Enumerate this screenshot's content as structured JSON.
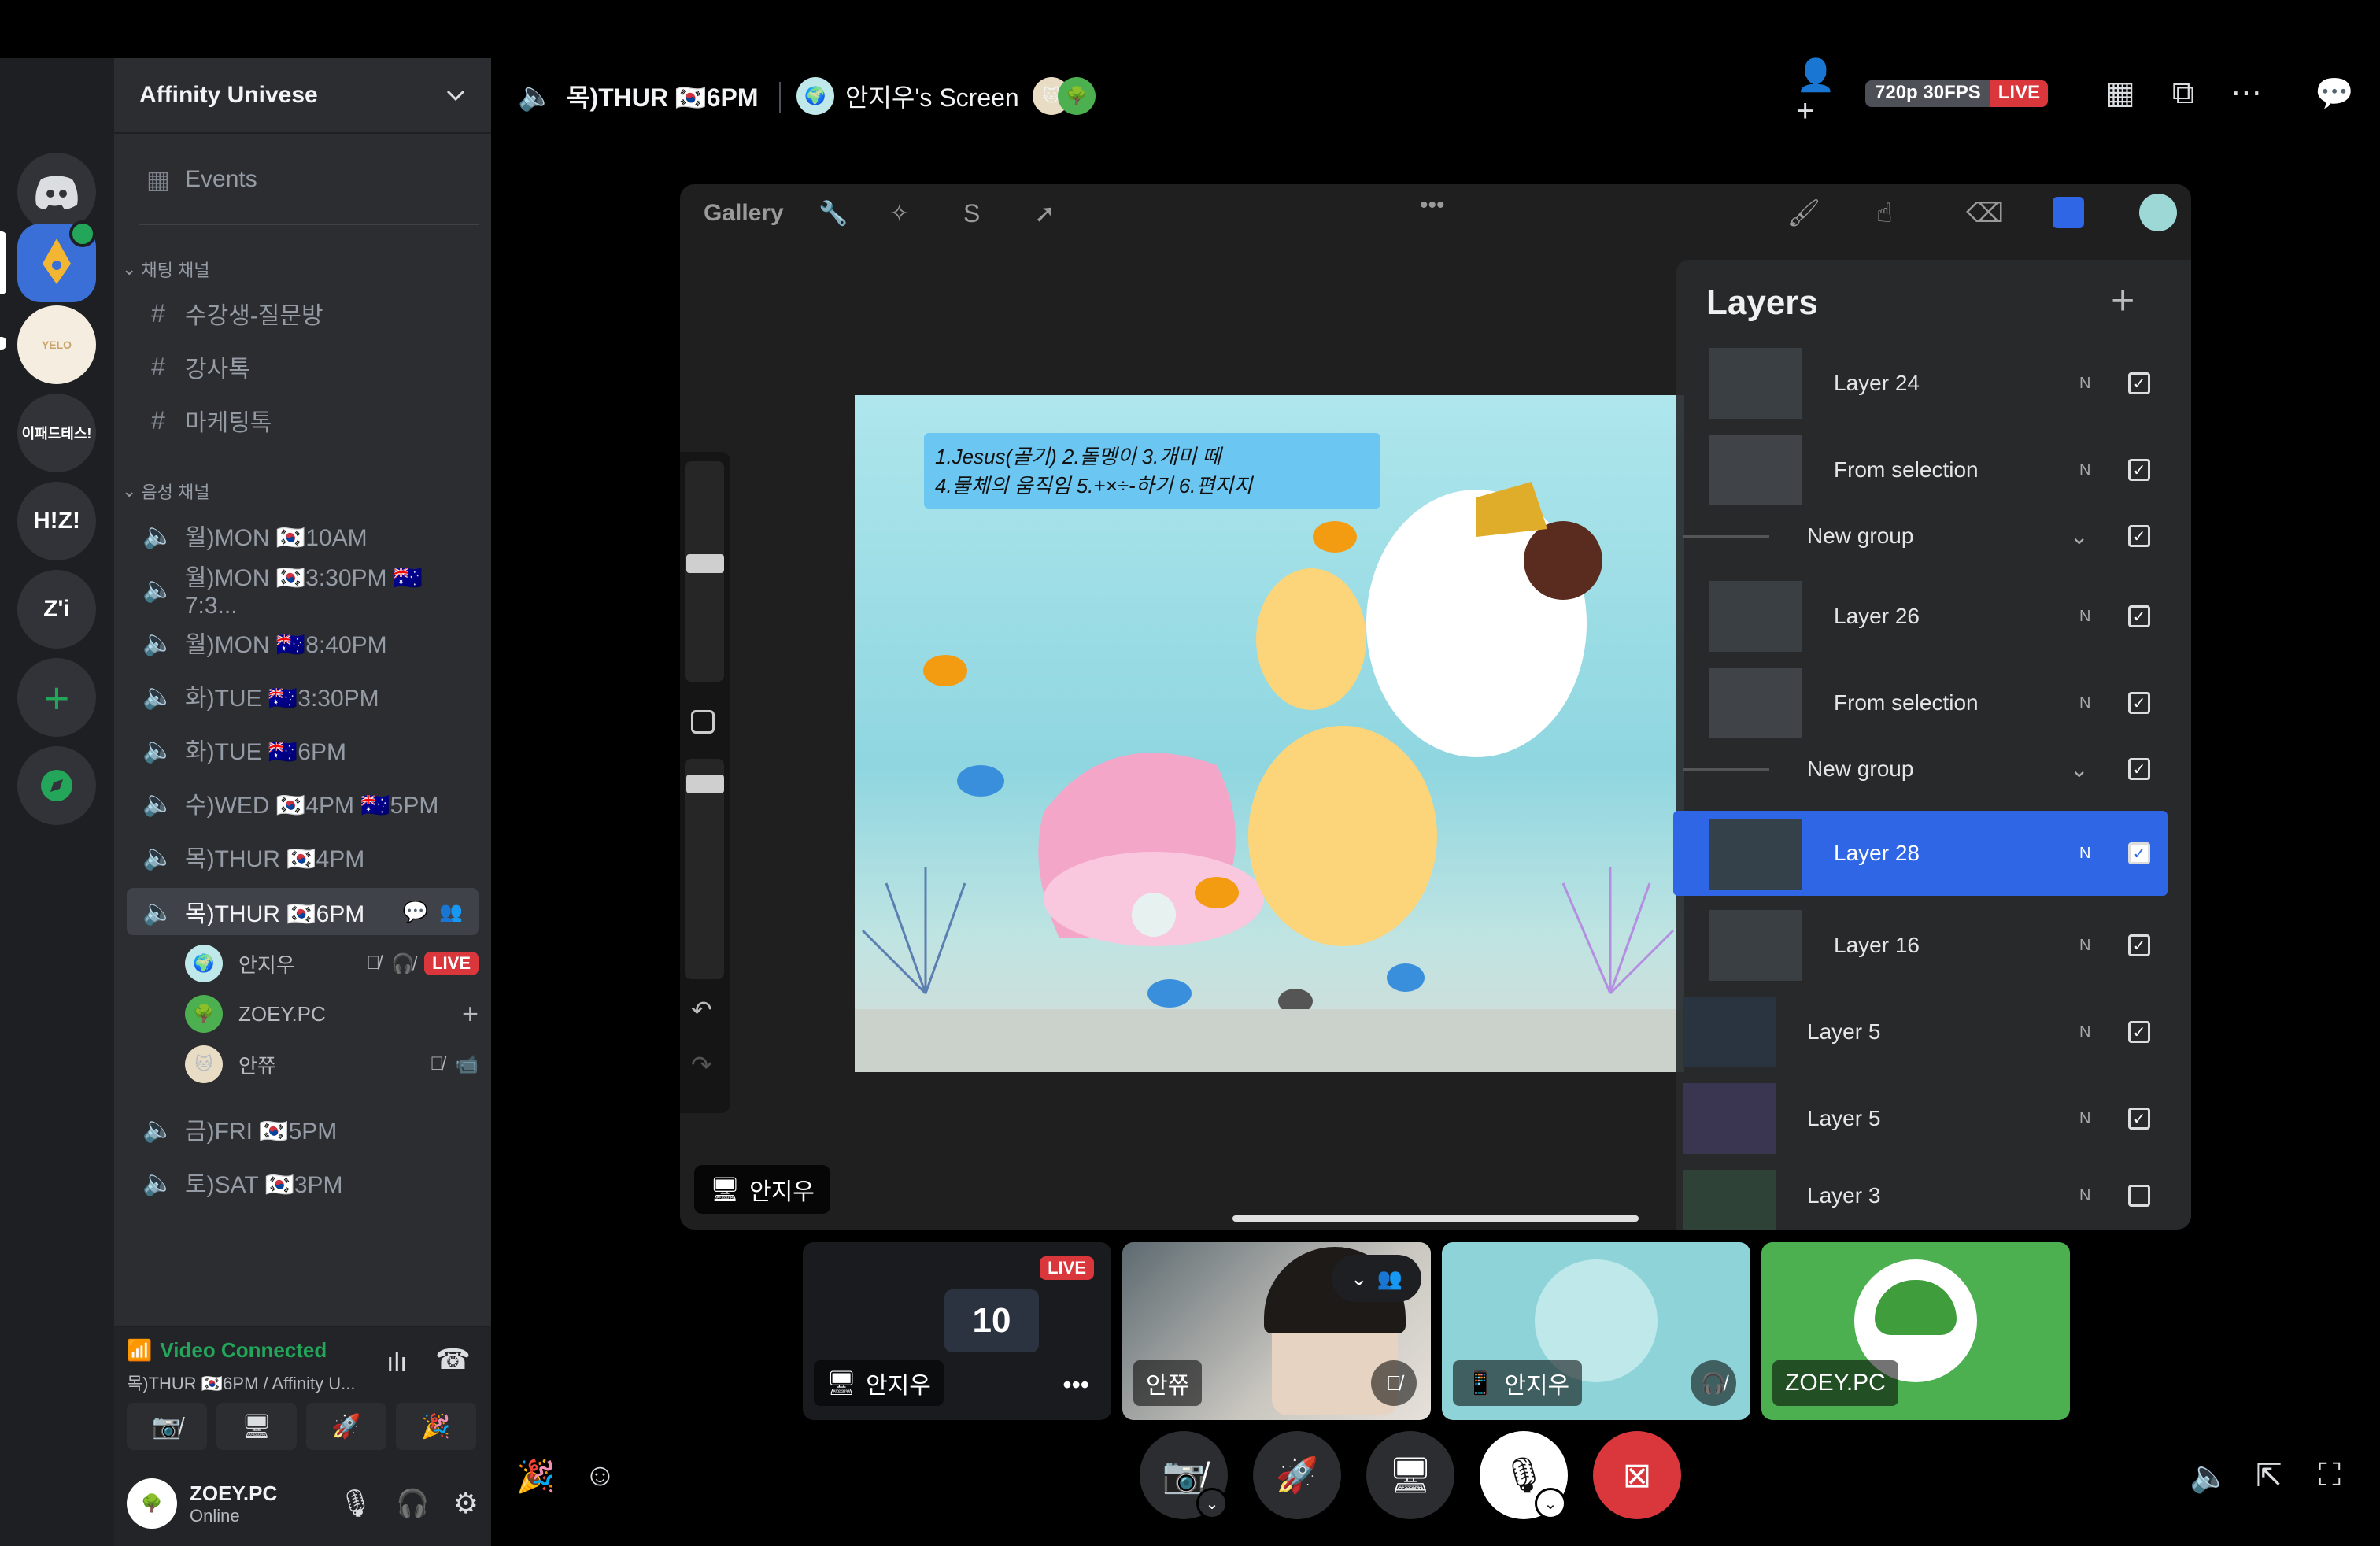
{
  "sidebar": {
    "server_name": "Affinity Univese",
    "events": "Events",
    "text_category": "채팅 채널",
    "text_channels": [
      "수강생-질문방",
      "강사톡",
      "마케팅톡"
    ],
    "voice_category": "음성 채널",
    "voice_channels": [
      "월)MON 🇰🇷10AM",
      "월)MON 🇰🇷3:30PM 🇦🇺7:3...",
      "월)MON 🇦🇺8:40PM",
      "화)TUE 🇦🇺3:30PM",
      "화)TUE 🇦🇺6PM",
      "수)WED 🇰🇷4PM 🇦🇺5PM",
      "목)THUR 🇰🇷4PM",
      "목)THUR 🇰🇷6PM"
    ],
    "voice_channels_after": [
      "금)FRI 🇰🇷5PM",
      "토)SAT 🇰🇷3PM"
    ],
    "participants": [
      {
        "name": "안지우",
        "badge": "LIVE"
      },
      {
        "name": "ZOEY.PC"
      },
      {
        "name": "안쮸"
      }
    ]
  },
  "rail": {
    "servers": [
      "",
      "",
      "",
      "이패드테스!",
      "H!Z!",
      "Z'i"
    ]
  },
  "voice_status": {
    "title": "Video Connected",
    "subtitle": "목)THUR 🇰🇷6PM / Affinity U..."
  },
  "user_panel": {
    "name": "ZOEY.PC",
    "status": "Online"
  },
  "topbar": {
    "channel": "목)THUR 🇰🇷6PM",
    "screen": "안지우's Screen",
    "quality": "720p 30FPS",
    "live": "LIVE"
  },
  "procreate": {
    "gallery": "Gallery",
    "layers_title": "Layers",
    "layers": [
      {
        "name": "Layer 24",
        "mode": "N",
        "checked": true
      },
      {
        "name": "From selection",
        "mode": "N",
        "checked": true
      },
      {
        "name": "New group",
        "mode": "",
        "checked": true
      },
      {
        "name": "Layer 26",
        "mode": "N",
        "checked": true
      },
      {
        "name": "From selection",
        "mode": "N",
        "checked": true
      },
      {
        "name": "New group",
        "mode": "",
        "checked": true
      },
      {
        "name": "Layer 28",
        "mode": "N",
        "checked": true
      },
      {
        "name": "Layer 16",
        "mode": "N",
        "checked": true
      },
      {
        "name": "Layer 5",
        "mode": "N",
        "checked": true
      },
      {
        "name": "Layer 5",
        "mode": "N",
        "checked": true
      },
      {
        "name": "Layer 3",
        "mode": "N",
        "checked": false
      }
    ],
    "note_line1": "1.Jesus(골기) 2.돌멩이  3.개미 떼",
    "note_line2": "4.물체의 움직임 5.+×÷-하기  6.편지지",
    "stage_user": "안지우"
  },
  "tiles": [
    {
      "name": "안지우",
      "badge": "LIVE",
      "number": "10"
    },
    {
      "name": "안쮸"
    },
    {
      "name": "안지우"
    },
    {
      "name": "ZOEY.PC"
    }
  ],
  "colors": {
    "accent": "#2f66e6",
    "live": "#da373c",
    "green": "#23a55a",
    "blurple": "#5865f2"
  }
}
